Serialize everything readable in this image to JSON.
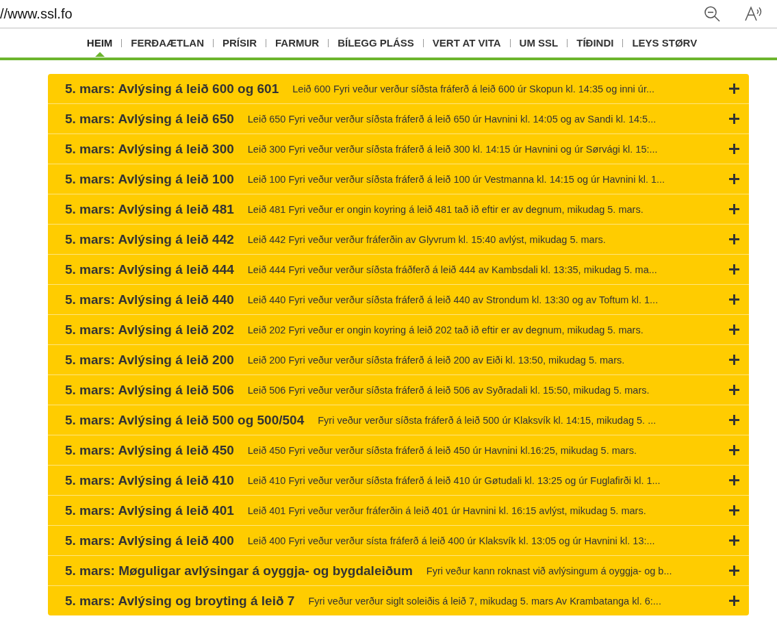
{
  "address_bar": {
    "url": "//www.ssl.fo"
  },
  "nav": [
    {
      "label": "HEIM",
      "selected": true
    },
    {
      "label": "FERÐAÆTLAN",
      "selected": false
    },
    {
      "label": "PRÍSIR",
      "selected": false
    },
    {
      "label": "FARMUR",
      "selected": false
    },
    {
      "label": "BÍLEGG PLÁSS",
      "selected": false
    },
    {
      "label": "VERT AT VITA",
      "selected": false
    },
    {
      "label": "UM SSL",
      "selected": false
    },
    {
      "label": "TÍÐINDI",
      "selected": false
    },
    {
      "label": "LEYS STØRV",
      "selected": false
    }
  ],
  "notices": [
    {
      "title": "5. mars: Avlýsing á leið 600 og 601",
      "summary": "Leið 600 Fyri veður verður síðsta fráferð á leið 600 úr Skopun kl. 14:35 og inni úr...",
      "expanded": false
    },
    {
      "title": "5. mars: Avlýsing á leið 650",
      "summary": "Leið 650 Fyri veður verður síðsta fráferð á leið 650 úr Havnini kl. 14:05 og av Sandi kl. 14:5...",
      "expanded": false
    },
    {
      "title": "5. mars: Avlýsing á leið 300",
      "summary": "Leið 300 Fyri veður verður síðsta fráferð á leið 300 kl. 14:15 úr Havnini og úr Sørvági kl. 15:...",
      "expanded": false
    },
    {
      "title": "5. mars: Avlýsing á leið 100",
      "summary": "Leið 100 Fyri veður verður síðsta fráferð á leið 100 úr Vestmanna kl. 14:15 og úr Havnini kl. 1...",
      "expanded": false
    },
    {
      "title": "5. mars: Avlýsing á leið 481",
      "summary": "Leið 481 Fyri veður er ongin koyring á leið 481 tað ið eftir er av degnum, mikudag 5. mars.",
      "expanded": false
    },
    {
      "title": "5. mars: Avlýsing á leið 442",
      "summary": "Leið 442 Fyri veður verður fráferðin av Glyvrum kl. 15:40 avlýst, mikudag 5. mars.",
      "expanded": false
    },
    {
      "title": "5. mars: Avlýsing á leið 444",
      "summary": "Leið 444 Fyri veður verður síðsta fráðferð á leið 444 av Kambsdali kl. 13:35, mikudag 5. ma...",
      "expanded": false
    },
    {
      "title": "5. mars: Avlýsing á leið 440",
      "summary": "Leið 440 Fyri veður verður síðsta fráferð á leið 440 av Strondum kl. 13:30 og av Toftum kl. 1...",
      "expanded": false
    },
    {
      "title": "5. mars: Avlýsing á leið 202",
      "summary": "Leið 202 Fyri veður er ongin koyring á leið 202 tað ið eftir er av degnum, mikudag 5. mars.",
      "expanded": false
    },
    {
      "title": "5. mars: Avlýsing á leið 200",
      "summary": "Leið 200 Fyri veður verður síðsta fráferð á leið 200 av Eiði kl. 13:50, mikudag 5. mars.",
      "expanded": false
    },
    {
      "title": "5. mars: Avlýsing á leið 506",
      "summary": "Leið 506 Fyri veður verður síðsta fráferð á leið 506 av Syðradali kl. 15:50, mikudag 5. mars.",
      "expanded": false
    },
    {
      "title": "5. mars: Avlýsing á leið 500 og 500/504",
      "summary": "Fyri veður verður síðsta fráferð á leið 500 úr Klaksvík kl. 14:15, mikudag 5. ...",
      "expanded": false
    },
    {
      "title": "5. mars: Avlýsing á leið 450",
      "summary": "Leið 450 Fyri veður verður síðsta fráferð á leið 450 úr Havnini kl.16:25, mikudag 5. mars.",
      "expanded": false
    },
    {
      "title": "5. mars: Avlýsing á leið 410",
      "summary": "Leið 410 Fyri veður verður síðsta fráferð á leið 410 úr Gøtudali kl. 13:25 og úr Fuglafirði kl. 1...",
      "expanded": false
    },
    {
      "title": "5. mars: Avlýsing á leið 401",
      "summary": "Leið 401 Fyri veður verður fráferðin á leið 401 úr Havnini kl. 16:15 avlýst, mikudag 5. mars.",
      "expanded": false
    },
    {
      "title": "5. mars: Avlýsing á leið 400",
      "summary": "Leið 400 Fyri veður verður sísta fráferð á leið 400 úr Klaksvík kl. 13:05 og úr Havnini kl. 13:...",
      "expanded": false
    },
    {
      "title": "5. mars: Møguligar avlýsingar á oyggja- og bygdaleiðum",
      "summary": "Fyri veður kann roknast við avlýsingum á oyggja- og b...",
      "expanded": false
    },
    {
      "title": "5. mars: Avlýsing og broyting á leið 7",
      "summary": "Fyri veður verður siglt soleiðis á leið 7, mikudag 5. mars Av Krambatanga kl. 6:...",
      "expanded": false
    }
  ]
}
